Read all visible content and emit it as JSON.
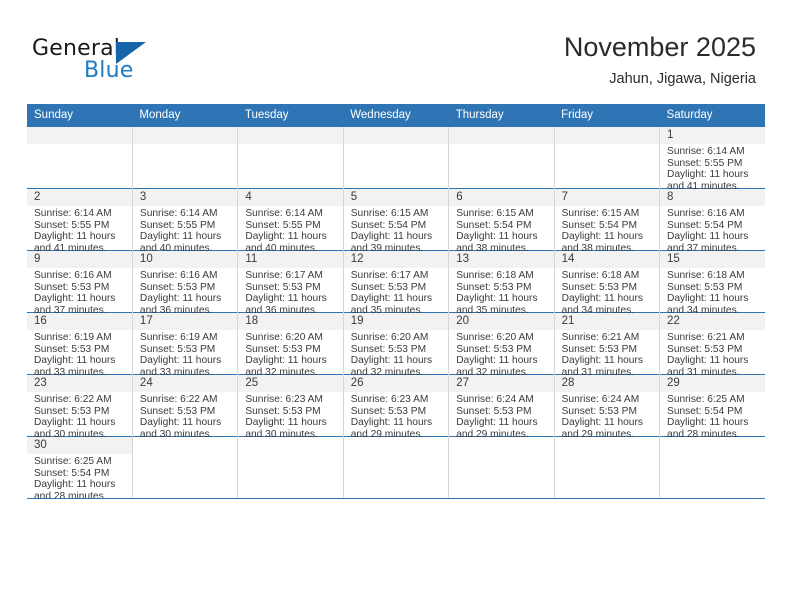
{
  "brand": {
    "name_top": "General",
    "name_bottom": "Blue",
    "accent_color": "#1f7bc1",
    "triangle_color": "#1565a8"
  },
  "header": {
    "title": "November 2025",
    "location": "Jahun, Jigawa, Nigeria"
  },
  "theme": {
    "header_blue": "#2f75b5",
    "daynum_bg": "#f2f2f2",
    "grid_line": "#d6d6d6",
    "text": "#3b3b3b"
  },
  "weekdays": [
    "Sunday",
    "Monday",
    "Tuesday",
    "Wednesday",
    "Thursday",
    "Friday",
    "Saturday"
  ],
  "weeks": [
    [
      {
        "day": "",
        "blank": true,
        "lines": []
      },
      {
        "day": "",
        "blank": true,
        "lines": []
      },
      {
        "day": "",
        "blank": true,
        "lines": []
      },
      {
        "day": "",
        "blank": true,
        "lines": []
      },
      {
        "day": "",
        "blank": true,
        "lines": []
      },
      {
        "day": "",
        "blank": true,
        "lines": []
      },
      {
        "day": "1",
        "lines": [
          "Sunrise: 6:14 AM",
          "Sunset: 5:55 PM",
          "Daylight: 11 hours",
          "and 41 minutes."
        ]
      }
    ],
    [
      {
        "day": "2",
        "lines": [
          "Sunrise: 6:14 AM",
          "Sunset: 5:55 PM",
          "Daylight: 11 hours",
          "and 41 minutes."
        ]
      },
      {
        "day": "3",
        "lines": [
          "Sunrise: 6:14 AM",
          "Sunset: 5:55 PM",
          "Daylight: 11 hours",
          "and 40 minutes."
        ]
      },
      {
        "day": "4",
        "lines": [
          "Sunrise: 6:14 AM",
          "Sunset: 5:55 PM",
          "Daylight: 11 hours",
          "and 40 minutes."
        ]
      },
      {
        "day": "5",
        "lines": [
          "Sunrise: 6:15 AM",
          "Sunset: 5:54 PM",
          "Daylight: 11 hours",
          "and 39 minutes."
        ]
      },
      {
        "day": "6",
        "lines": [
          "Sunrise: 6:15 AM",
          "Sunset: 5:54 PM",
          "Daylight: 11 hours",
          "and 38 minutes."
        ]
      },
      {
        "day": "7",
        "lines": [
          "Sunrise: 6:15 AM",
          "Sunset: 5:54 PM",
          "Daylight: 11 hours",
          "and 38 minutes."
        ]
      },
      {
        "day": "8",
        "lines": [
          "Sunrise: 6:16 AM",
          "Sunset: 5:54 PM",
          "Daylight: 11 hours",
          "and 37 minutes."
        ]
      }
    ],
    [
      {
        "day": "9",
        "lines": [
          "Sunrise: 6:16 AM",
          "Sunset: 5:53 PM",
          "Daylight: 11 hours",
          "and 37 minutes."
        ]
      },
      {
        "day": "10",
        "lines": [
          "Sunrise: 6:16 AM",
          "Sunset: 5:53 PM",
          "Daylight: 11 hours",
          "and 36 minutes."
        ]
      },
      {
        "day": "11",
        "lines": [
          "Sunrise: 6:17 AM",
          "Sunset: 5:53 PM",
          "Daylight: 11 hours",
          "and 36 minutes."
        ]
      },
      {
        "day": "12",
        "lines": [
          "Sunrise: 6:17 AM",
          "Sunset: 5:53 PM",
          "Daylight: 11 hours",
          "and 35 minutes."
        ]
      },
      {
        "day": "13",
        "lines": [
          "Sunrise: 6:18 AM",
          "Sunset: 5:53 PM",
          "Daylight: 11 hours",
          "and 35 minutes."
        ]
      },
      {
        "day": "14",
        "lines": [
          "Sunrise: 6:18 AM",
          "Sunset: 5:53 PM",
          "Daylight: 11 hours",
          "and 34 minutes."
        ]
      },
      {
        "day": "15",
        "lines": [
          "Sunrise: 6:18 AM",
          "Sunset: 5:53 PM",
          "Daylight: 11 hours",
          "and 34 minutes."
        ]
      }
    ],
    [
      {
        "day": "16",
        "lines": [
          "Sunrise: 6:19 AM",
          "Sunset: 5:53 PM",
          "Daylight: 11 hours",
          "and 33 minutes."
        ]
      },
      {
        "day": "17",
        "lines": [
          "Sunrise: 6:19 AM",
          "Sunset: 5:53 PM",
          "Daylight: 11 hours",
          "and 33 minutes."
        ]
      },
      {
        "day": "18",
        "lines": [
          "Sunrise: 6:20 AM",
          "Sunset: 5:53 PM",
          "Daylight: 11 hours",
          "and 32 minutes."
        ]
      },
      {
        "day": "19",
        "lines": [
          "Sunrise: 6:20 AM",
          "Sunset: 5:53 PM",
          "Daylight: 11 hours",
          "and 32 minutes."
        ]
      },
      {
        "day": "20",
        "lines": [
          "Sunrise: 6:20 AM",
          "Sunset: 5:53 PM",
          "Daylight: 11 hours",
          "and 32 minutes."
        ]
      },
      {
        "day": "21",
        "lines": [
          "Sunrise: 6:21 AM",
          "Sunset: 5:53 PM",
          "Daylight: 11 hours",
          "and 31 minutes."
        ]
      },
      {
        "day": "22",
        "lines": [
          "Sunrise: 6:21 AM",
          "Sunset: 5:53 PM",
          "Daylight: 11 hours",
          "and 31 minutes."
        ]
      }
    ],
    [
      {
        "day": "23",
        "lines": [
          "Sunrise: 6:22 AM",
          "Sunset: 5:53 PM",
          "Daylight: 11 hours",
          "and 30 minutes."
        ]
      },
      {
        "day": "24",
        "lines": [
          "Sunrise: 6:22 AM",
          "Sunset: 5:53 PM",
          "Daylight: 11 hours",
          "and 30 minutes."
        ]
      },
      {
        "day": "25",
        "lines": [
          "Sunrise: 6:23 AM",
          "Sunset: 5:53 PM",
          "Daylight: 11 hours",
          "and 30 minutes."
        ]
      },
      {
        "day": "26",
        "lines": [
          "Sunrise: 6:23 AM",
          "Sunset: 5:53 PM",
          "Daylight: 11 hours",
          "and 29 minutes."
        ]
      },
      {
        "day": "27",
        "lines": [
          "Sunrise: 6:24 AM",
          "Sunset: 5:53 PM",
          "Daylight: 11 hours",
          "and 29 minutes."
        ]
      },
      {
        "day": "28",
        "lines": [
          "Sunrise: 6:24 AM",
          "Sunset: 5:53 PM",
          "Daylight: 11 hours",
          "and 29 minutes."
        ]
      },
      {
        "day": "29",
        "lines": [
          "Sunrise: 6:25 AM",
          "Sunset: 5:54 PM",
          "Daylight: 11 hours",
          "and 28 minutes."
        ]
      }
    ],
    [
      {
        "day": "30",
        "lines": [
          "Sunrise: 6:25 AM",
          "Sunset: 5:54 PM",
          "Daylight: 11 hours",
          "and 28 minutes."
        ]
      },
      {
        "day": "",
        "blank": true,
        "lines": []
      },
      {
        "day": "",
        "blank": true,
        "lines": []
      },
      {
        "day": "",
        "blank": true,
        "lines": []
      },
      {
        "day": "",
        "blank": true,
        "lines": []
      },
      {
        "day": "",
        "blank": true,
        "lines": []
      },
      {
        "day": "",
        "blank": true,
        "lines": []
      }
    ]
  ]
}
